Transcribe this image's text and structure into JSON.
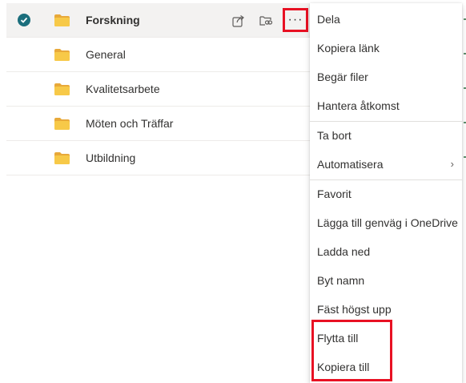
{
  "files": [
    {
      "name": "Forskning",
      "selected": true
    },
    {
      "name": "General",
      "selected": false
    },
    {
      "name": "Kvalitetsarbete",
      "selected": false
    },
    {
      "name": "Möten och Träffar",
      "selected": false
    },
    {
      "name": "Utbildning",
      "selected": false
    }
  ],
  "row_actions": {
    "more_label": "···"
  },
  "context_menu": {
    "items": [
      {
        "label": "Dela"
      },
      {
        "label": "Kopiera länk"
      },
      {
        "label": "Begär filer"
      },
      {
        "label": "Hantera åtkomst"
      },
      {
        "label": "Ta bort"
      },
      {
        "label": "Automatisera",
        "submenu": true
      },
      {
        "label": "Favorit"
      },
      {
        "label": "Lägga till genväg i OneDrive"
      },
      {
        "label": "Ladda ned"
      },
      {
        "label": "Byt namn"
      },
      {
        "label": "Fäst högst upp"
      },
      {
        "label": "Flytta till"
      },
      {
        "label": "Kopiera till"
      }
    ],
    "submenu_chevron": "›"
  },
  "icons": {
    "selected_check": "check-circle-icon",
    "folder": "folder-icon",
    "share": "share-icon",
    "copy_link": "copy-link-icon",
    "more": "more-icon"
  },
  "colors": {
    "folder": "#f7c948",
    "folder_dark": "#e8a93a",
    "check": "#1b6e7c",
    "highlight": "#e81123",
    "selected_row": "#f3f2f1"
  }
}
